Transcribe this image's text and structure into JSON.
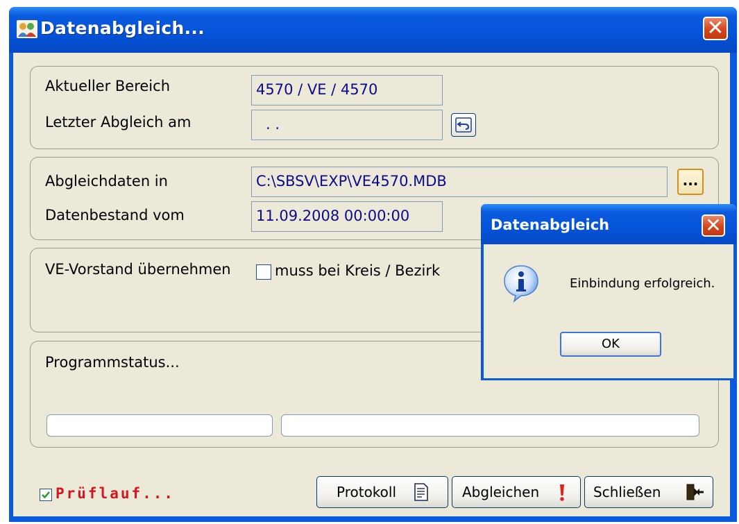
{
  "window": {
    "title": "Datenabgleich...",
    "close_glyph": "✕"
  },
  "group1": {
    "label_area": "Aktueller Bereich",
    "value_area": "4570 / VE / 4570",
    "label_last": "Letzter Abgleich am",
    "value_last": " .  .",
    "reset_icon": "undo-arrow-icon"
  },
  "group2": {
    "label_path": "Abgleichdaten in",
    "value_path": "C:\\SBSV\\EXP\\VE4570.MDB",
    "browse_label": "...",
    "label_date": "Datenbestand vom",
    "value_date": "11.09.2008 00:00:00"
  },
  "group3": {
    "label": "VE-Vorstand übernehmen",
    "checkbox_label": "muss bei Kreis / Bezirk",
    "checked": false
  },
  "group4": {
    "label": "Programmstatus..."
  },
  "footer": {
    "pruflauf_label": "Prüflauf...",
    "pruflauf_checked": true,
    "protokoll_label": "Protokoll",
    "abgleichen_label": "Abgleichen",
    "schliessen_label": "Schließen"
  },
  "dialog": {
    "title": "Datenabgleich",
    "message": "Einbindung erfolgreich.",
    "ok_label": "OK",
    "icon": "info-icon"
  },
  "colors": {
    "titlebar": "#0a5ade",
    "face": "#ece9d8",
    "value_text": "#0b0b8c",
    "pruflauf_text": "#d4141e"
  }
}
